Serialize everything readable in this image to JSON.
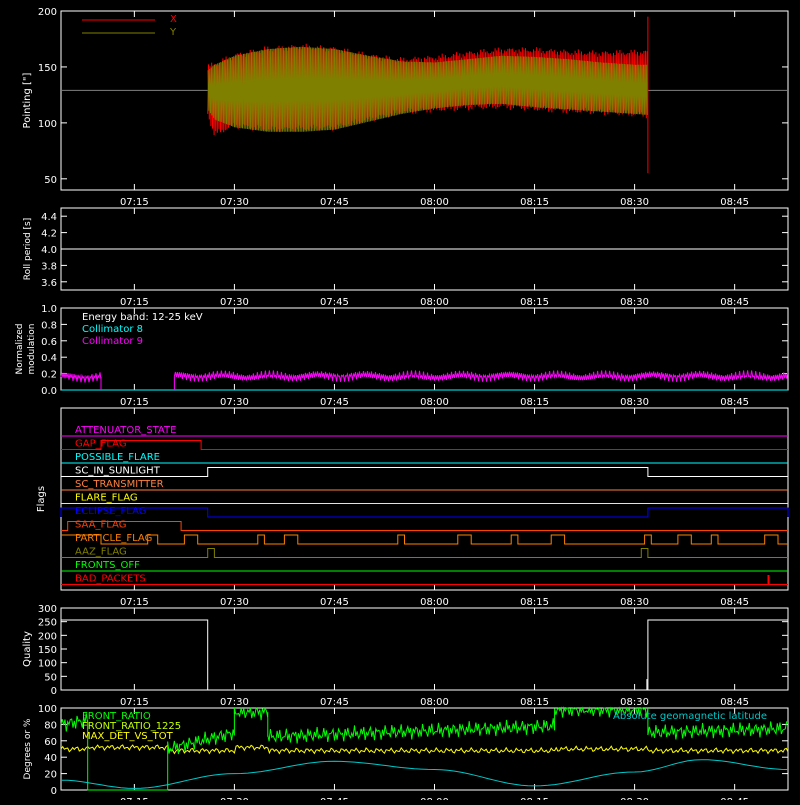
{
  "colors": {
    "axis": "#ffffff",
    "x_series": "#ff0000",
    "y_series": "#808000",
    "grey_line": "#808080",
    "collimator8": "#00ffff",
    "collimator9": "#ff00ff",
    "front_ratio": "#00ff00",
    "front_ratio_1225": "#c0ff00",
    "max_det_vs_tot": "#ffff00",
    "geomag": "#00c8c8"
  },
  "time_ticks": [
    "07:15",
    "07:30",
    "07:45",
    "08:00",
    "08:15",
    "08:30",
    "08:45"
  ],
  "chart_data": [
    {
      "id": "pointing",
      "type": "line",
      "ylabel": "Pointing [\"]",
      "ylim": [
        40,
        200
      ],
      "yticks": [
        "200",
        "150",
        "100",
        "50"
      ],
      "legend": [
        "X",
        "Y"
      ],
      "series": [
        {
          "name": "X",
          "color_key": "x_series"
        },
        {
          "name": "Y",
          "color_key": "y_series"
        }
      ],
      "envelope": {
        "x": [
          "07:26",
          "07:27",
          "07:30",
          "07:35",
          "07:40",
          "07:45",
          "07:50",
          "07:55",
          "08:00",
          "08:05",
          "08:10",
          "08:15",
          "08:20",
          "08:25",
          "08:30",
          "08:32"
        ],
        "y_upper": [
          147,
          152,
          160,
          166,
          168,
          166,
          160,
          155,
          154,
          157,
          160,
          159,
          157,
          154,
          152,
          152
        ],
        "y_lower": [
          112,
          103,
          96,
          92,
          92,
          94,
          101,
          108,
          113,
          116,
          117,
          114,
          112,
          110,
          108,
          107
        ],
        "x_upper": [
          150,
          152,
          160,
          166,
          168,
          166,
          160,
          156,
          158,
          162,
          165,
          165,
          163,
          162,
          163,
          163
        ],
        "x_lower": [
          108,
          90,
          98,
          94,
          95,
          96,
          103,
          110,
          112,
          114,
          115,
          113,
          111,
          110,
          108,
          107
        ]
      },
      "baseline": 129
    },
    {
      "id": "roll_period",
      "type": "line",
      "ylabel": "Roll period [s]",
      "ylim": [
        3.5,
        4.5
      ],
      "yticks": [
        "4.4",
        "4.2",
        "4.0",
        "3.8",
        "3.6"
      ],
      "value": 4.0
    },
    {
      "id": "modulation",
      "type": "line",
      "ylabel": [
        "Normalized",
        "modulation"
      ],
      "ylim": [
        0,
        1
      ],
      "yticks": [
        "1.0",
        "0.8",
        "0.6",
        "0.4",
        "0.2",
        "0.0"
      ],
      "legend": [
        "Energy band: 12-25 keV",
        "Collimator 8",
        "Collimator 9"
      ],
      "segments": [
        {
          "from": "07:04",
          "to": "07:10",
          "level": 0.16
        },
        {
          "from": "07:21",
          "to": "08:53",
          "level": 0.17
        }
      ]
    },
    {
      "id": "flags",
      "type": "line",
      "ylabel": "Flags",
      "rows": [
        {
          "label": "ATTENUATOR_STATE",
          "color": "#ff00ff",
          "changes": []
        },
        {
          "label": "GAP_FLAG",
          "color": "#ff0000",
          "high": [
            [
              "07:10",
              "07:25"
            ]
          ]
        },
        {
          "label": "POSSIBLE_FLARE",
          "color": "#00ffff",
          "high": []
        },
        {
          "label": "SC_IN_SUNLIGHT",
          "color": "#ffffff",
          "high": [
            [
              "07:26",
              "08:32"
            ]
          ]
        },
        {
          "label": "SC_TRANSMITTER",
          "color": "#ff8040",
          "high": []
        },
        {
          "label": "FLARE_FLAG",
          "color": "#ffff00",
          "high": []
        },
        {
          "label": "ECLIPSE_FLAG",
          "color": "#0000ff",
          "high": [
            [
              "07:04",
              "07:26"
            ],
            [
              "08:32",
              "08:53"
            ]
          ]
        },
        {
          "label": "SAA_FLAG",
          "color": "#ff4000",
          "high": [
            [
              "07:05",
              "07:22"
            ]
          ]
        },
        {
          "label": "PARTICLE_FLAG",
          "color": "#ff8000",
          "spikes": true
        },
        {
          "label": "AAZ_FLAG",
          "color": "#808000",
          "high": [
            [
              "07:26",
              "07:27"
            ],
            [
              "08:31",
              "08:32"
            ]
          ]
        },
        {
          "label": "FRONTS_OFF",
          "color": "#00ff00",
          "high": []
        },
        {
          "label": "BAD_PACKETS",
          "color": "#ff0000",
          "high": [
            [
              "08:50",
              "08:50"
            ]
          ]
        }
      ]
    },
    {
      "id": "quality",
      "type": "line",
      "ylabel": "Quality",
      "ylim": [
        0,
        300
      ],
      "yticks": [
        "300",
        "250",
        "200",
        "150",
        "100",
        "50",
        "0"
      ],
      "segments": [
        {
          "from": "07:04",
          "to": "07:26",
          "level": 256
        },
        {
          "from": "07:26",
          "to": "08:32",
          "level": 0
        },
        {
          "from": "08:32",
          "to": "08:53",
          "level": 256
        }
      ]
    },
    {
      "id": "degrees",
      "type": "line",
      "ylabel": "Degrees or %",
      "ylim": [
        0,
        100
      ],
      "yticks": [
        "100",
        "80",
        "60",
        "40",
        "20",
        "0"
      ],
      "legend": [
        "FRONT_RATIO",
        "FRONT_RATIO_1225",
        "MAX_DET_VS_TOT"
      ],
      "right_label": "Absolute geomagnetic latitude",
      "front_ratio": {
        "x": [
          "07:04",
          "07:08",
          "07:08",
          "07:20",
          "07:20",
          "07:30",
          "07:30",
          "07:35",
          "07:35",
          "08:18",
          "08:18",
          "08:32",
          "08:32",
          "08:53"
        ],
        "y": [
          80,
          85,
          0,
          0,
          50,
          70,
          95,
          95,
          65,
          78,
          98,
          98,
          70,
          75
        ]
      },
      "max_det": {
        "x": [
          "07:04",
          "07:08",
          "07:20",
          "07:30",
          "07:35",
          "08:18",
          "08:32",
          "08:53"
        ],
        "y": [
          50,
          52,
          48,
          52,
          48,
          50,
          48,
          50
        ]
      },
      "geomag": {
        "x": [
          "07:04",
          "07:15",
          "07:30",
          "07:45",
          "08:00",
          "08:15",
          "08:30",
          "08:40",
          "08:53"
        ],
        "y": [
          12,
          2,
          20,
          35,
          25,
          5,
          22,
          37,
          25
        ]
      }
    }
  ]
}
